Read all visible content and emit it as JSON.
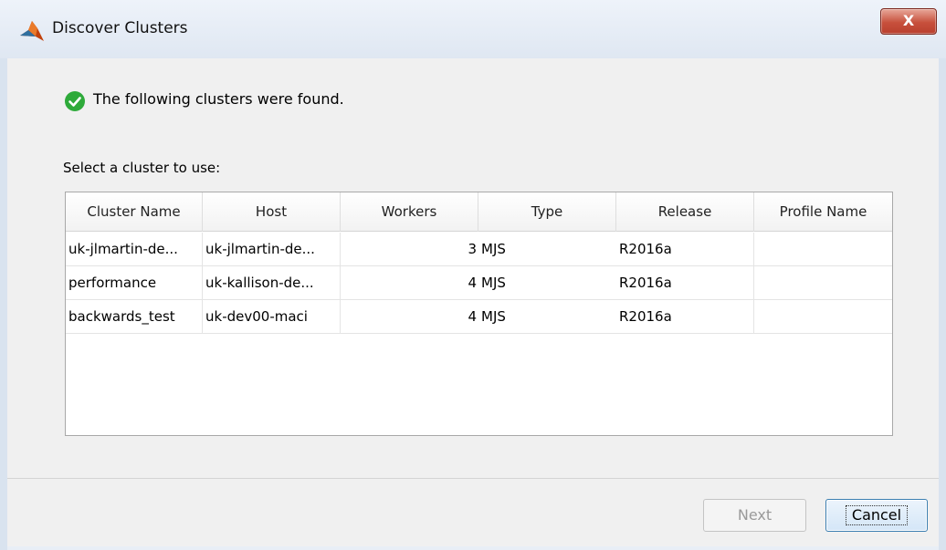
{
  "window": {
    "title": "Discover Clusters",
    "close_label": "X",
    "app_icon": "matlab-icon"
  },
  "content": {
    "status_icon": "check-circle-icon",
    "status_message": "The following clusters were found.",
    "select_label": "Select a cluster to use:"
  },
  "table": {
    "columns": [
      "Cluster Name",
      "Host",
      "Workers",
      "Type",
      "Release",
      "Profile Name"
    ],
    "rows": [
      {
        "cluster_name": "uk-jlmartin-de...",
        "host": "uk-jlmartin-de...",
        "workers": "3",
        "type": "MJS",
        "release": "R2016a",
        "profile_name": ""
      },
      {
        "cluster_name": "performance",
        "host": "uk-kallison-de...",
        "workers": "4",
        "type": "MJS",
        "release": "R2016a",
        "profile_name": ""
      },
      {
        "cluster_name": "backwards_test",
        "host": "uk-dev00-maci",
        "workers": "4",
        "type": "MJS",
        "release": "R2016a",
        "profile_name": ""
      }
    ]
  },
  "buttons": {
    "next_label": "Next",
    "cancel_label": "Cancel"
  },
  "colors": {
    "close_red": "#c7503c",
    "success_green": "#2eaa3a",
    "focus_blue": "#3c7fb1"
  }
}
